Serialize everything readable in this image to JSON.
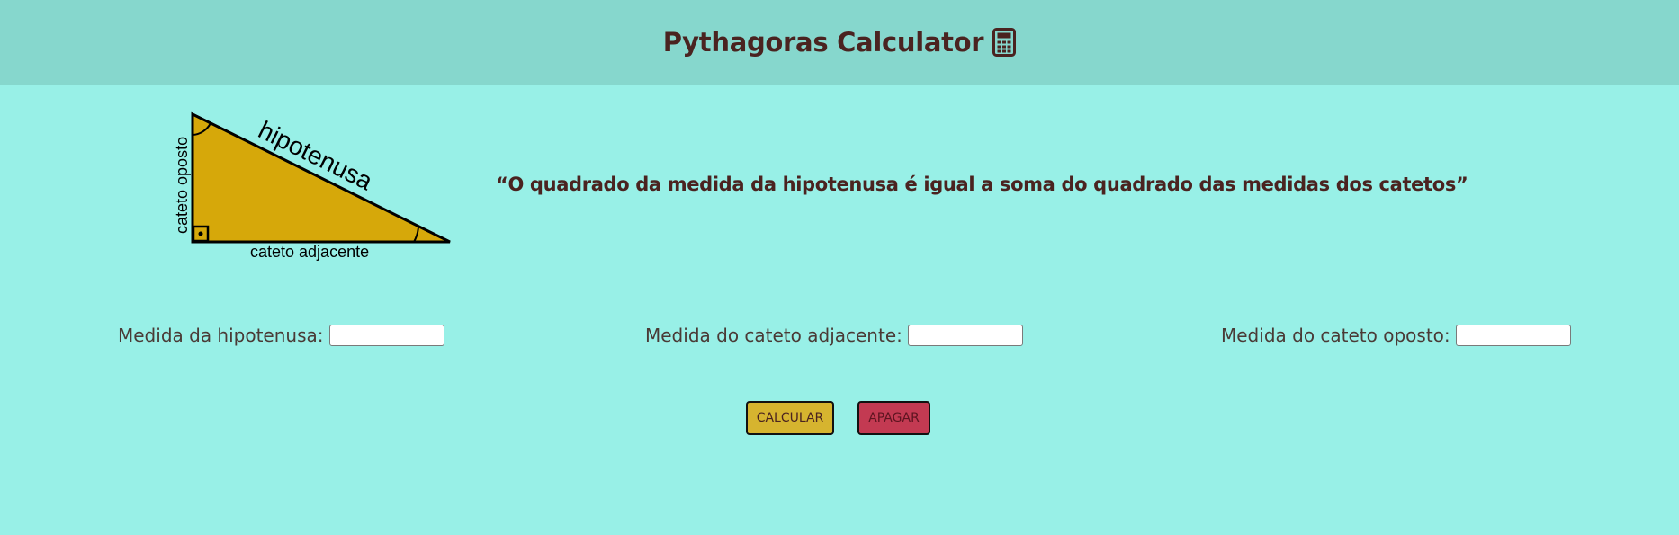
{
  "header": {
    "title": "Pythagoras Calculator",
    "icon": "calculator-icon"
  },
  "figure": {
    "hypotenuse_label": "hipotenusa",
    "opposite_label": "cateto oposto",
    "adjacent_label": "cateto adjacente",
    "fill_color": "#d6a80a"
  },
  "quote": "“O quadrado da medida da hipotenusa é igual a soma do quadrado das medidas dos catetos”",
  "fields": {
    "hypotenuse": {
      "label": "Medida da hipotenusa:",
      "value": ""
    },
    "adjacent": {
      "label": "Medida do cateto adjacente:",
      "value": ""
    },
    "opposite": {
      "label": "Medida do cateto oposto:",
      "value": ""
    }
  },
  "buttons": {
    "calculate": "CALCULAR",
    "clear": "APAGAR"
  },
  "colors": {
    "background": "#98f0e7",
    "header": "#86d7cd",
    "text": "#4a2320",
    "calculate_button": "#d6b42f",
    "clear_button": "#c33a52"
  }
}
